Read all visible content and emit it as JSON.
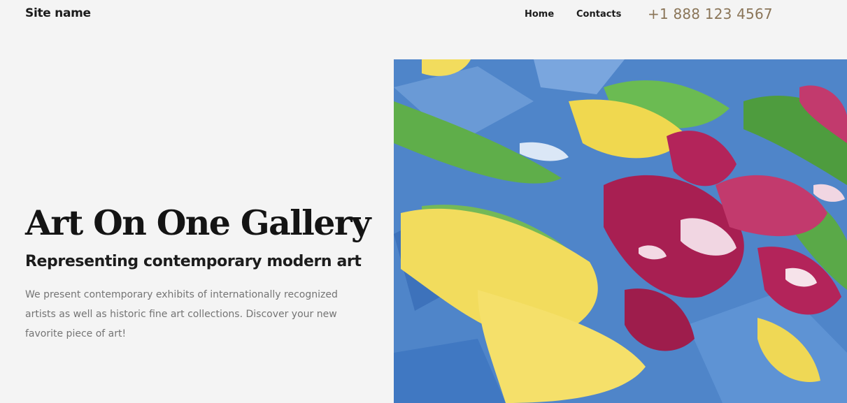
{
  "header": {
    "site_name": "Site name",
    "nav": [
      {
        "label": "Home"
      },
      {
        "label": "Contacts"
      }
    ],
    "phone": "+1 888 123 4567"
  },
  "hero": {
    "title": "Art On One Gallery",
    "subtitle": "Representing contemporary modern art",
    "description": "We present contemporary exhibits of internationally recognized artists as well as historic fine art collections. Discover your new favorite piece of art!",
    "image_icon": "abstract-painting-image"
  },
  "colors": {
    "background": "#f4f4f4",
    "text_dark": "#141414",
    "text_muted": "#747474",
    "phone_accent": "#8a7558",
    "paint_blue": "#4f85c9",
    "paint_yellow": "#f2dc5d",
    "paint_green": "#5fae4a",
    "paint_magenta": "#b3245a"
  }
}
